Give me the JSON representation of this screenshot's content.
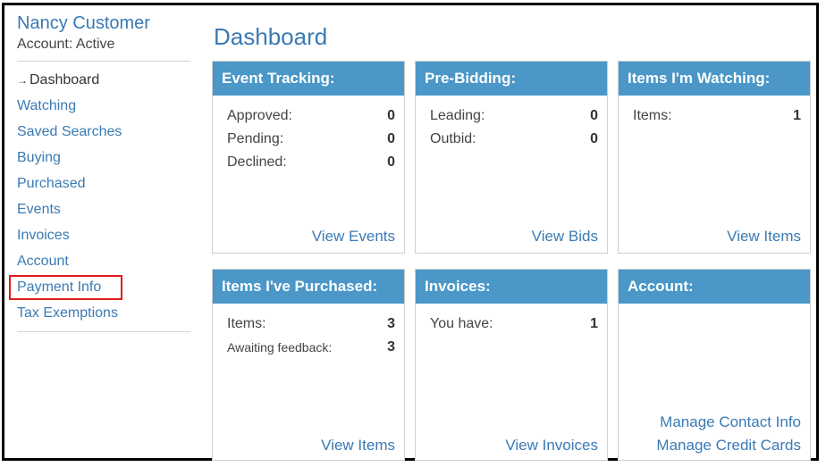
{
  "sidebar": {
    "user_name": "Nancy Customer",
    "account_status": "Account: Active",
    "current_arrow": "→",
    "items": [
      {
        "label": "Dashboard"
      },
      {
        "label": "Watching"
      },
      {
        "label": "Saved Searches"
      },
      {
        "label": "Buying"
      },
      {
        "label": "Purchased"
      },
      {
        "label": "Events"
      },
      {
        "label": "Invoices"
      },
      {
        "label": "Account"
      },
      {
        "label": "Payment Info"
      },
      {
        "label": "Tax Exemptions"
      }
    ]
  },
  "main": {
    "title": "Dashboard",
    "cards": {
      "event_tracking": {
        "title": "Event Tracking:",
        "rows": [
          {
            "label": "Approved:",
            "value": "0"
          },
          {
            "label": "Pending:",
            "value": "0"
          },
          {
            "label": "Declined:",
            "value": "0"
          }
        ],
        "link": "View Events"
      },
      "pre_bidding": {
        "title": "Pre-Bidding:",
        "rows": [
          {
            "label": "Leading:",
            "value": "0"
          },
          {
            "label": "Outbid:",
            "value": "0"
          }
        ],
        "link": "View Bids"
      },
      "watching": {
        "title": "Items I'm Watching:",
        "rows": [
          {
            "label": "Items:",
            "value": "1"
          }
        ],
        "link": "View Items"
      },
      "purchased": {
        "title": "Items I've Purchased:",
        "rows": [
          {
            "label": "Items:",
            "value": "3"
          },
          {
            "label": "Awaiting feedback:",
            "value": "3"
          }
        ],
        "link": "View Items"
      },
      "invoices": {
        "title": "Invoices:",
        "rows": [
          {
            "label": "You have:",
            "value": "1"
          }
        ],
        "link": "View Invoices"
      },
      "account": {
        "title": "Account:",
        "links": [
          "Manage Contact Info",
          "Manage Credit Cards"
        ]
      }
    }
  },
  "colors": {
    "accent": "#3a7ab4",
    "card_header": "#4a97c8",
    "highlight": "#e01b1b"
  }
}
